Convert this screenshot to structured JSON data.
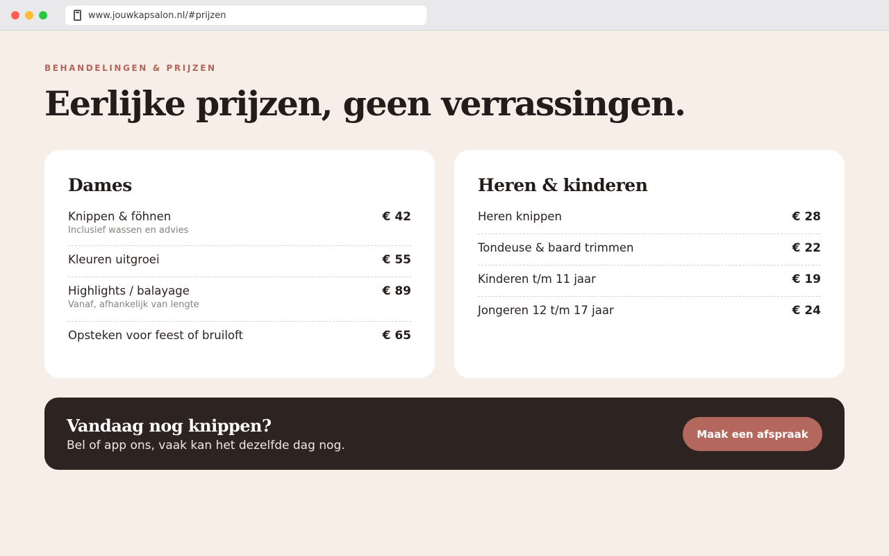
{
  "browser": {
    "url": "www.jouwkapsalon.nl/#prijzen",
    "page_icon": "page-icon"
  },
  "section": {
    "eyebrow": "BEHANDELINGEN & PRIJZEN",
    "title": "Eerlijke prijzen, geen verrassingen."
  },
  "cards": {
    "dames": {
      "title": "Dames",
      "items": [
        {
          "name": "Knippen & föhnen",
          "sub": "Inclusief wassen en advies",
          "price": "€ 42"
        },
        {
          "name": "Kleuren uitgroei",
          "price": "€ 55"
        },
        {
          "name": "Highlights / balayage",
          "sub": "Vanaf, afhankelijk van lengte",
          "price": "€ 89"
        },
        {
          "name": "Opsteken voor feest of bruiloft",
          "price": "€ 65"
        }
      ]
    },
    "heren": {
      "title": "Heren & kinderen",
      "items": [
        {
          "name": "Heren knippen",
          "price": "€ 28"
        },
        {
          "name": "Tondeuse & baard trimmen",
          "price": "€ 22"
        },
        {
          "name": "Kinderen t/m 11 jaar",
          "price": "€ 19"
        },
        {
          "name": "Jongeren 12 t/m 17 jaar",
          "price": "€ 24"
        }
      ]
    }
  },
  "cta": {
    "title": "Vandaag nog knippen?",
    "subtitle": "Bel of app ons, vaak kan het dezelfde dag nog.",
    "button_label": "Maak een afspraak"
  },
  "colors": {
    "accent": "#b4675c",
    "background": "#f7eee8",
    "dark": "#2d2321"
  }
}
